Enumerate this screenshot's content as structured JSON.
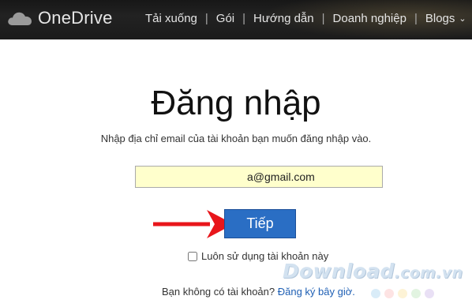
{
  "header": {
    "logo_text": "OneDrive",
    "logo_icon": "cloud-icon",
    "nav": [
      {
        "label": "Tải xuống"
      },
      {
        "label": "Gói"
      },
      {
        "label": "Hướng dẫn"
      },
      {
        "label": "Doanh nghiệp"
      },
      {
        "label": "Blogs"
      }
    ],
    "separator": "|",
    "dropdown_icon": "chevron-down-icon"
  },
  "main": {
    "title": "Đăng nhập",
    "subtitle": "Nhập địa chỉ email của tài khoản bạn muốn đăng nhập vào.",
    "email_value": "a@gmail.com",
    "next_label": "Tiếp",
    "remember_label": "Luôn sử dụng tài khoản này",
    "remember_checked": false,
    "signup_question": "Bạn không có tài khoản?",
    "signup_link": "Đăng ký bây giờ."
  },
  "annotation": {
    "arrow_icon": "arrow-right-icon",
    "arrow_color": "#e8161b"
  },
  "watermark": {
    "brand": "Download",
    "domain": ".com.vn",
    "dot_colors": [
      "#d9ecf8",
      "#fde3e3",
      "#fdf3d6",
      "#e2f4e1",
      "#e9e0f5"
    ]
  },
  "colors": {
    "accent": "#2a6ec4",
    "link": "#1e5fb4",
    "email_bg": "#ffffcc",
    "topbar": "#1b1b1b"
  }
}
